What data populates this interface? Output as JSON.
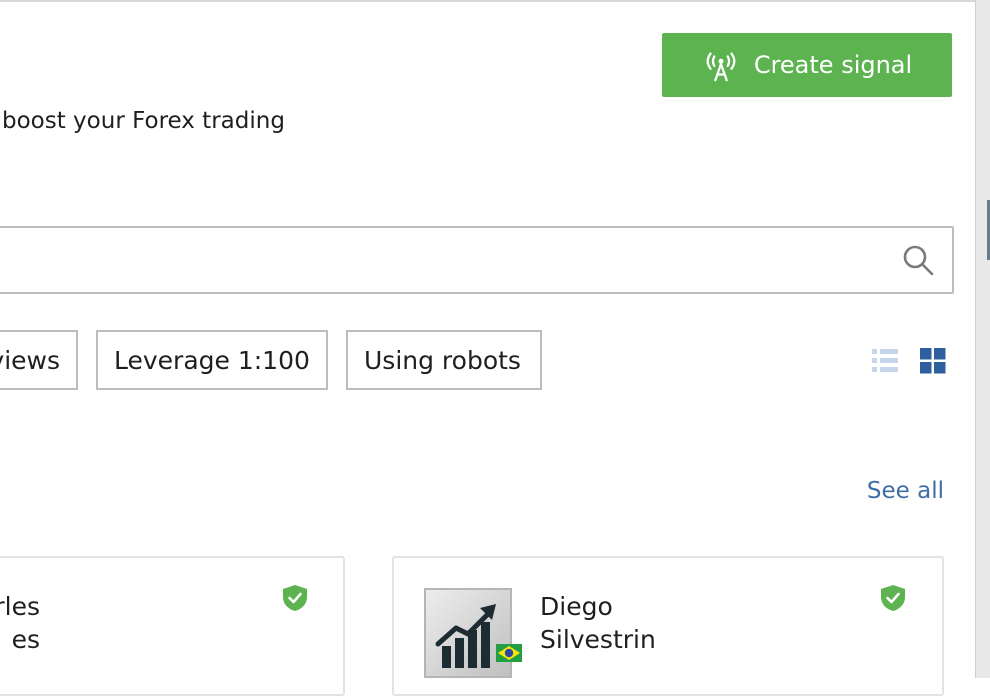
{
  "header": {
    "create_signal_label": "Create signal",
    "subtitle": "boost your Forex trading"
  },
  "search": {
    "placeholder": ""
  },
  "tags": {
    "reviews": "views",
    "leverage": "Leverage 1:100",
    "robots": "Using robots"
  },
  "section": {
    "see_all": "See all"
  },
  "cards": [
    {
      "name_line1": "rles",
      "name_line2": "es",
      "verified": true
    },
    {
      "name_line1": "Diego",
      "name_line2": "Silvestrin",
      "verified": true,
      "flag": "Brazil"
    }
  ],
  "icons": {
    "create_signal": "antenna-icon",
    "search": "search-icon",
    "list_view": "list-view-icon",
    "grid_view": "grid-view-icon",
    "verified": "shield-check-icon"
  },
  "colors": {
    "accent_green": "#5cb350",
    "link_blue": "#3e6ea6",
    "grid_icon_active": "#2f5f9e",
    "list_icon_inactive": "#c5d5ea",
    "verified_green": "#5cb350"
  }
}
